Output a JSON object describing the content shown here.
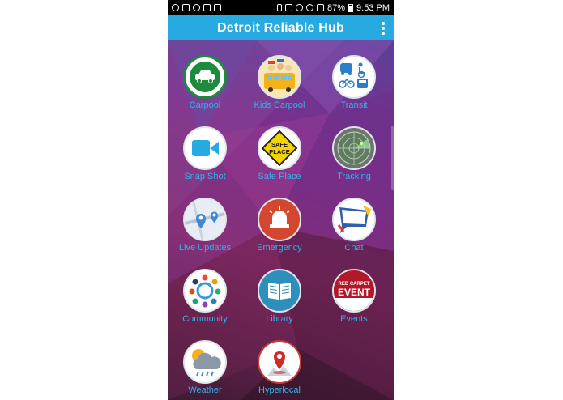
{
  "status_bar": {
    "battery": "87%",
    "time": "9:53 PM"
  },
  "app_bar": {
    "title": "Detroit Reliable Hub",
    "menu_icon": "overflow-menu-icon"
  },
  "tiles": [
    {
      "label": "Carpool",
      "icon": "car-icon"
    },
    {
      "label": "Kids Carpool",
      "icon": "school-bus-kids-icon"
    },
    {
      "label": "Transit",
      "icon": "transit-icon"
    },
    {
      "label": "Snap Shot",
      "icon": "video-camera-icon"
    },
    {
      "label": "Safe Place",
      "icon": "safe-place-sign-icon"
    },
    {
      "label": "Tracking",
      "icon": "radar-icon"
    },
    {
      "label": "Live Updates",
      "icon": "map-pin-icon"
    },
    {
      "label": "Emergency",
      "icon": "siren-icon"
    },
    {
      "label": "Chat",
      "icon": "chat-bubble-icon"
    },
    {
      "label": "Community",
      "icon": "community-people-icon"
    },
    {
      "label": "Library",
      "icon": "book-icon"
    },
    {
      "label": "Events",
      "icon": "red-carpet-event-icon"
    },
    {
      "label": "Weather",
      "icon": "weather-cloud-icon"
    },
    {
      "label": "Hyperlocal",
      "icon": "location-pin-icon"
    }
  ],
  "events_icon_text": {
    "line1": "RED CARPET",
    "line2": "EVENT"
  },
  "safe_place_text": {
    "line1": "SAFE",
    "line2": "PLACE"
  },
  "colors": {
    "app_bar": "#27aae1",
    "label": "#31b3ec",
    "status_bar": "#000000"
  }
}
